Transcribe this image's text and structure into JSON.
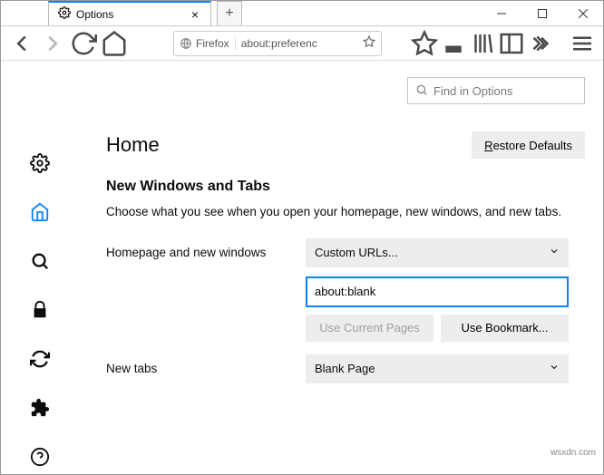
{
  "window": {
    "tab_label": "Options",
    "newtab": "+",
    "min": "minimize",
    "max": "maximize",
    "close": "close"
  },
  "toolbar": {
    "identity": "Firefox",
    "url": "about:preferenc",
    "back": "back",
    "forward": "forward",
    "reload": "reload",
    "home": "home",
    "star": "bookmark"
  },
  "search": {
    "placeholder": "Find in Options"
  },
  "page": {
    "title": "Home",
    "restore_r": "R",
    "restore_rest": "estore Defaults"
  },
  "section": {
    "title": "New Windows and Tabs",
    "desc": "Choose what you see when you open your homepage, new windows, and new tabs."
  },
  "homepage": {
    "label": "Homepage and new windows",
    "select_value": "Custom URLs...",
    "url_value": "about:blank",
    "use_current": "Use Current Pages",
    "use_bookmark": "Use Bookmark..."
  },
  "newtabs": {
    "label": "New tabs",
    "select_value": "Blank Page"
  },
  "watermark": "wsxdn.com"
}
